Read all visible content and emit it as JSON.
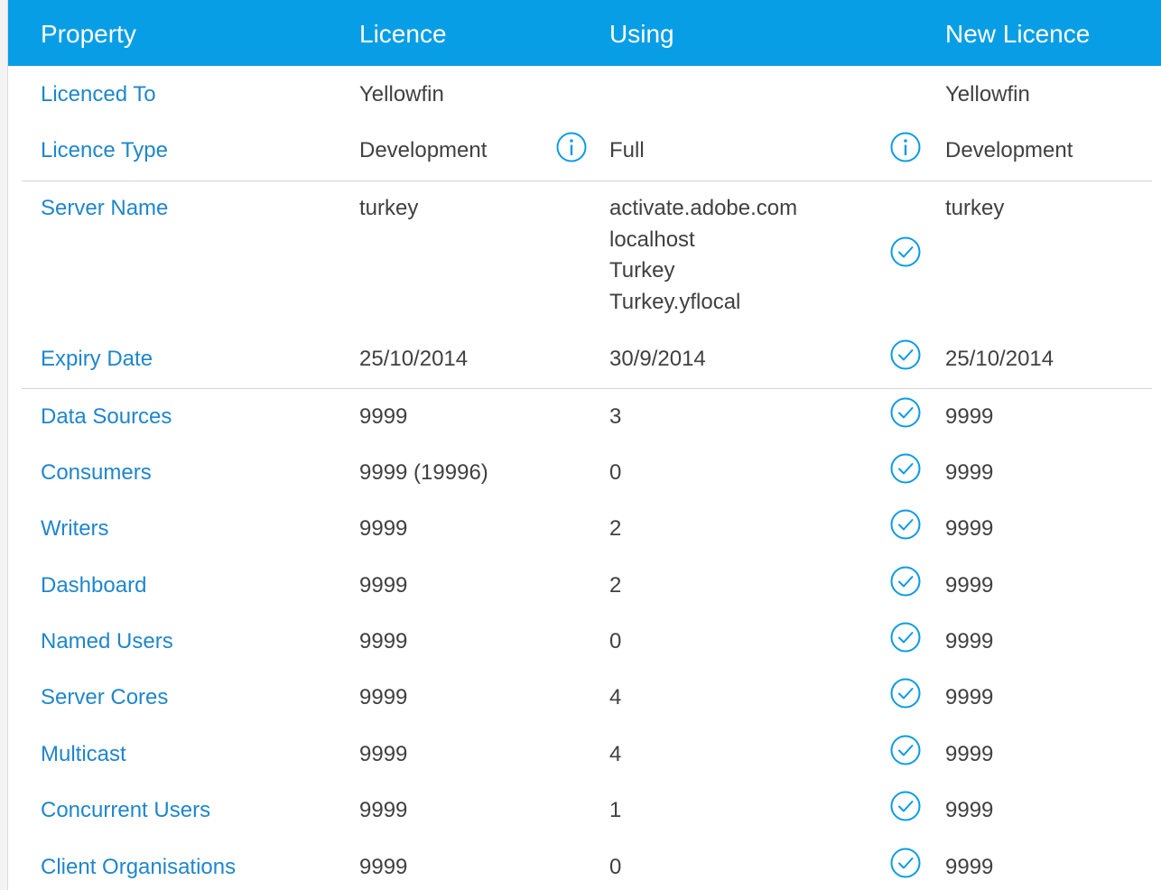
{
  "header": {
    "property": "Property",
    "licence": "Licence",
    "using": "Using",
    "new_licence": "New Licence"
  },
  "colors": {
    "header_bg": "#079ee6",
    "property_text": "#1f86cc",
    "value_text": "#404040",
    "icon": "#0b9be6"
  },
  "rows": [
    {
      "property": "Licenced To",
      "licence": "Yellowfin",
      "using": "",
      "status_icon": "none",
      "new_licence": "Yellowfin"
    },
    {
      "property": "Licence Type",
      "licence": "Development",
      "using": "Full",
      "licence_icon": "info-icon",
      "status_icon": "info-icon",
      "new_licence": "Development"
    },
    {
      "property": "Server Name",
      "licence": "turkey",
      "using": [
        "activate.adobe.com",
        "localhost",
        "Turkey",
        "Turkey.yflocal"
      ],
      "status_icon": "check-circle-icon",
      "new_licence": "turkey"
    },
    {
      "property": "Expiry Date",
      "licence": "25/10/2014",
      "using": "30/9/2014",
      "status_icon": "check-circle-icon",
      "new_licence": "25/10/2014"
    },
    {
      "property": "Data Sources",
      "licence": "9999",
      "using": "3",
      "status_icon": "check-circle-icon",
      "new_licence": "9999"
    },
    {
      "property": "Consumers",
      "licence": "9999 (19996)",
      "using": "0",
      "status_icon": "check-circle-icon",
      "new_licence": "9999"
    },
    {
      "property": "Writers",
      "licence": "9999",
      "using": "2",
      "status_icon": "check-circle-icon",
      "new_licence": "9999"
    },
    {
      "property": "Dashboard",
      "licence": "9999",
      "using": "2",
      "status_icon": "check-circle-icon",
      "new_licence": "9999"
    },
    {
      "property": "Named Users",
      "licence": "9999",
      "using": "0",
      "status_icon": "check-circle-icon",
      "new_licence": "9999"
    },
    {
      "property": "Server Cores",
      "licence": "9999",
      "using": "4",
      "status_icon": "check-circle-icon",
      "new_licence": "9999"
    },
    {
      "property": "Multicast",
      "licence": "9999",
      "using": "4",
      "status_icon": "check-circle-icon",
      "new_licence": "9999"
    },
    {
      "property": "Concurrent Users",
      "licence": "9999",
      "using": "1",
      "status_icon": "check-circle-icon",
      "new_licence": "9999"
    },
    {
      "property": "Client Organisations",
      "licence": "9999",
      "using": "0",
      "status_icon": "check-circle-icon",
      "new_licence": "9999"
    }
  ]
}
